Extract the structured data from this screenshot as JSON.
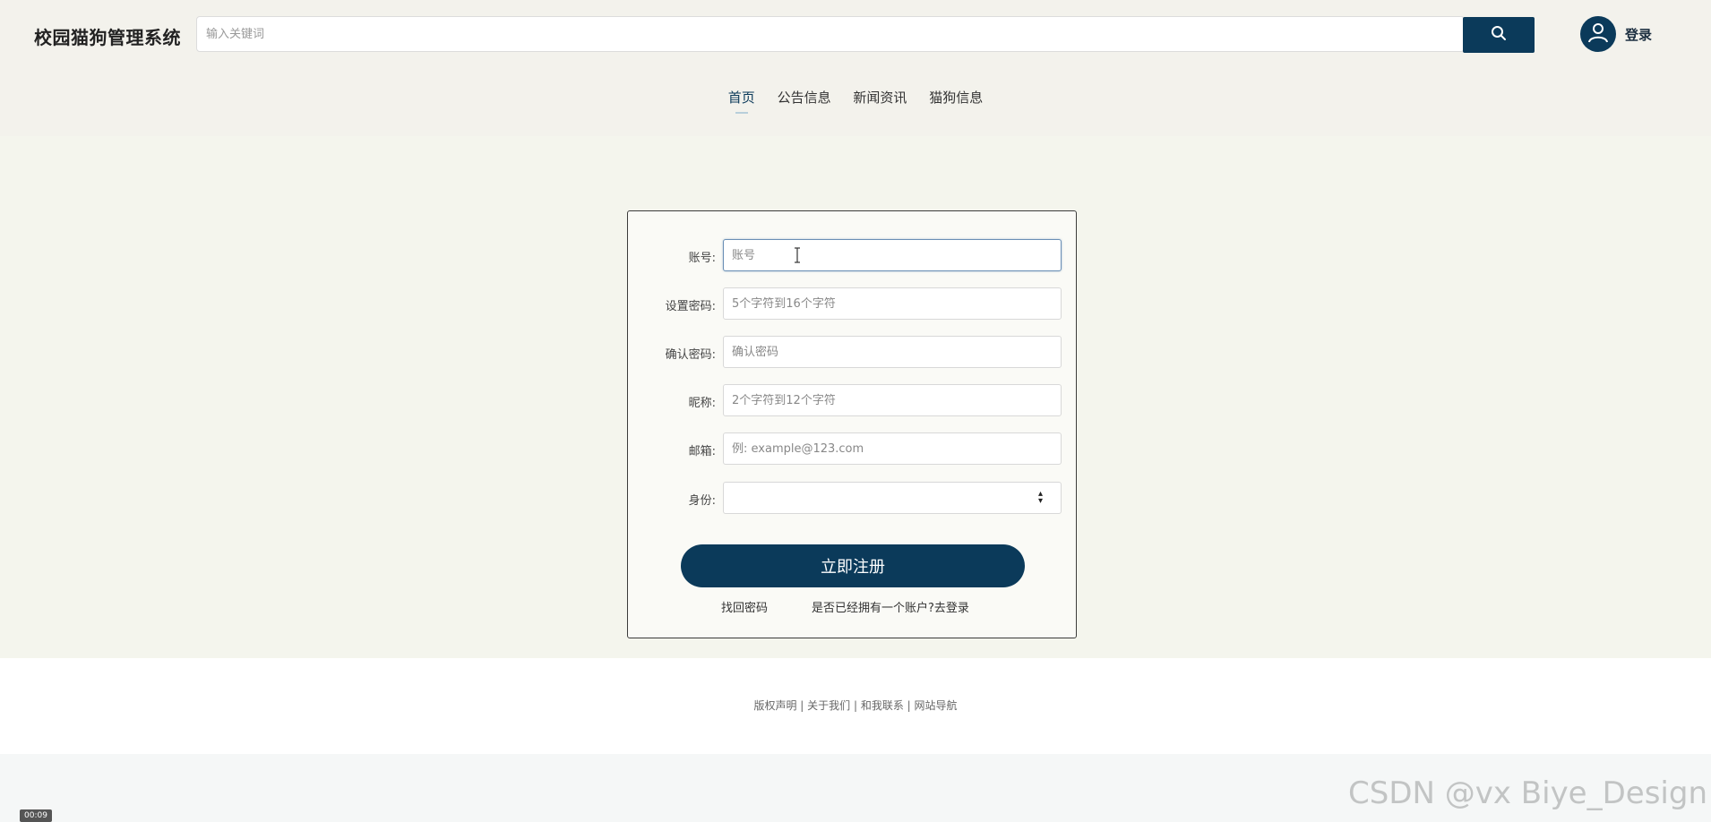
{
  "header": {
    "site_title": "校园猫狗管理系统",
    "search_placeholder": "输入关键词",
    "search_icon": "search-icon",
    "avatar_icon": "user-icon",
    "login_label": "登录",
    "accent_color": "#0b3a5a"
  },
  "nav": {
    "items": [
      {
        "label": "首页",
        "active": true
      },
      {
        "label": "公告信息",
        "active": false
      },
      {
        "label": "新闻资讯",
        "active": false
      },
      {
        "label": "猫狗信息",
        "active": false
      }
    ]
  },
  "form": {
    "fields": [
      {
        "label": "账号:",
        "placeholder": "账号",
        "value": ""
      },
      {
        "label": "设置密码:",
        "placeholder": "5个字符到16个字符",
        "value": ""
      },
      {
        "label": "确认密码:",
        "placeholder": "确认密码",
        "value": ""
      },
      {
        "label": "昵称:",
        "placeholder": "2个字符到12个字符",
        "value": ""
      },
      {
        "label": "邮箱:",
        "placeholder": "例: example@123.com",
        "value": ""
      },
      {
        "label": "身份:",
        "selected_value": ""
      }
    ],
    "register_label": "立即注册",
    "forgot_label": "找回密码",
    "login_prompt": "是否已经拥有一个账户?去登录"
  },
  "footer": {
    "links": "版权声明 | 关于我们 | 和我联系 | 网站导航"
  },
  "overlay": {
    "watermark": "CSDN @vx Biye_Design",
    "video_time": "00:09"
  }
}
